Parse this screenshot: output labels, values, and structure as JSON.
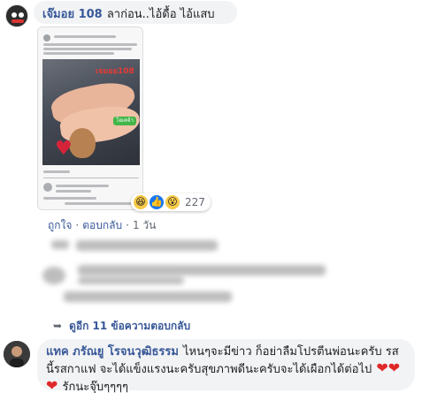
{
  "comment1": {
    "author": "เจ๊มอย 108",
    "text": "ลาก่อน..ไอ้ดื้อ ไอ้แสบ",
    "image": {
      "watermark": "เจมอย108",
      "line_badge": "โอเคจ้า"
    },
    "reactions": {
      "icons": [
        "haha-icon",
        "like-icon",
        "wow-icon"
      ],
      "count": "227"
    },
    "actions": {
      "like": "ถูกใจ",
      "reply": "ตอบกลับ",
      "time": "1 วัน"
    }
  },
  "more_replies": "ดูอีก 11 ข้อความตอบกลับ",
  "comment2": {
    "author": "แทค ภรัณยู โรจนวุฒิธรรม",
    "text": "ไหนๆจะมีข่าว ก็อย่าลืมโปรตีนพ่อนะครับ รสนี้รสกาแฟ จะได้แข็งแรงนะครับสุขภาพดีนะครับจะได้เผือกได้ต่อไป",
    "hearts": "❤❤❤",
    "tail": "รักนะจุ๊บๆๆๆๆ"
  },
  "colors": {
    "link": "#385898",
    "bubble": "#f2f3f5",
    "heart": "#e02828"
  }
}
